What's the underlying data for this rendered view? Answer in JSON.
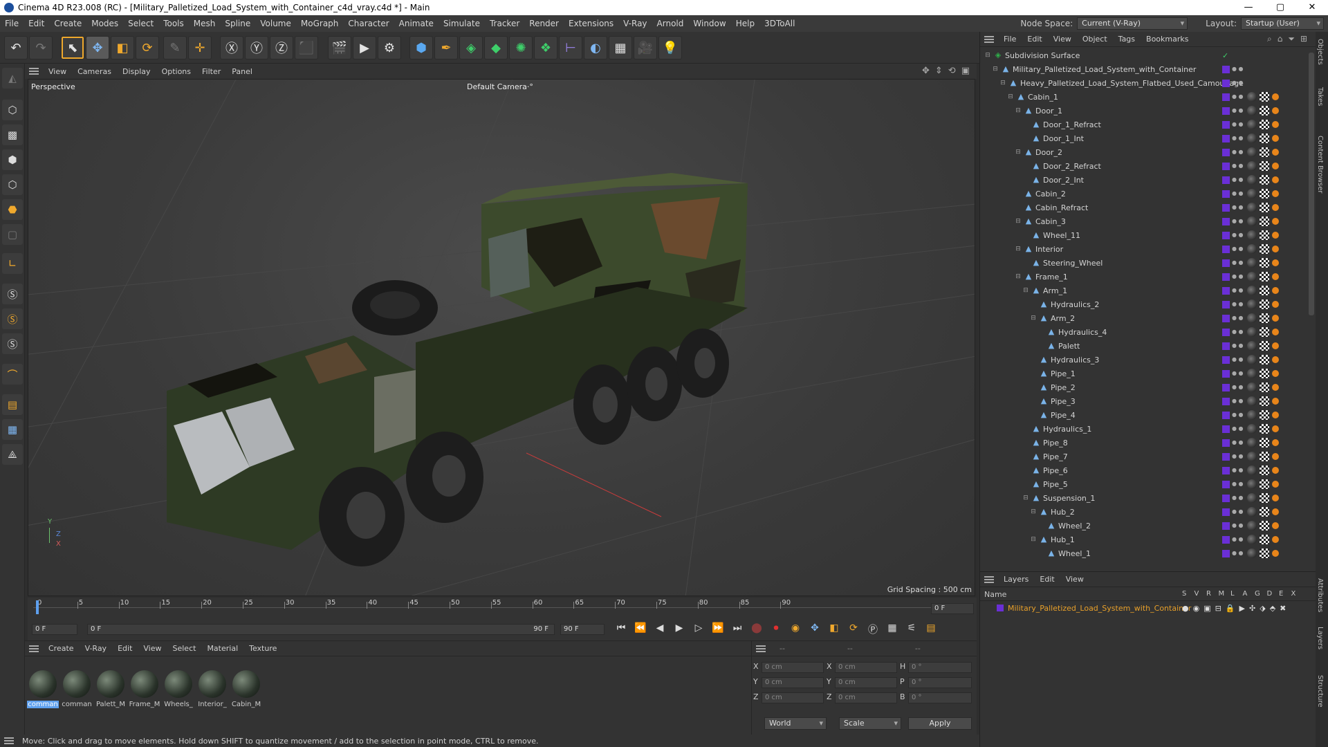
{
  "window": {
    "title": "Cinema 4D R23.008 (RC) - [Military_Palletized_Load_System_with_Container_c4d_vray.c4d *] - Main",
    "minimize": "—",
    "maximize": "▢",
    "close": "✕"
  },
  "menu": [
    "File",
    "Edit",
    "Create",
    "Modes",
    "Select",
    "Tools",
    "Mesh",
    "Spline",
    "Volume",
    "MoGraph",
    "Character",
    "Animate",
    "Simulate",
    "Tracker",
    "Render",
    "Extensions",
    "V-Ray",
    "Arnold",
    "Window",
    "Help",
    "3DToAll"
  ],
  "nodespace": {
    "label": "Node Space:",
    "value": "Current (V-Ray)"
  },
  "layout": {
    "label": "Layout:",
    "value": "Startup (User)"
  },
  "viewport": {
    "menu": [
      "View",
      "Cameras",
      "Display",
      "Options",
      "Filter",
      "Panel"
    ],
    "name": "Perspective",
    "camera": "Default Camera",
    "camera_icon": "·°",
    "grid_spacing": "Grid Spacing : 500 cm",
    "axis_y": "Y",
    "axis_z": "Z",
    "axis_x": "X"
  },
  "timeline": {
    "ticks": [
      "0",
      "5",
      "10",
      "15",
      "20",
      "25",
      "30",
      "35",
      "40",
      "45",
      "50",
      "55",
      "60",
      "65",
      "70",
      "75",
      "80",
      "85",
      "90"
    ],
    "current_frame": "0 F",
    "start": "0 F",
    "range_start": "0 F",
    "range_end": "90 F",
    "end": "90 F"
  },
  "materials": {
    "menu": [
      "Create",
      "V-Ray",
      "Edit",
      "View",
      "Select",
      "Material",
      "Texture"
    ],
    "items": [
      "comman",
      "comman",
      "Palett_M",
      "Frame_M",
      "Wheels_",
      "Interior_",
      "Cabin_M"
    ]
  },
  "coords": {
    "rows": [
      {
        "a": "X",
        "av": "0 cm",
        "b": "X",
        "bv": "0 cm",
        "c": "H",
        "cv": "0 °"
      },
      {
        "a": "Y",
        "av": "0 cm",
        "b": "Y",
        "bv": "0 cm",
        "c": "P",
        "cv": "0 °"
      },
      {
        "a": "Z",
        "av": "0 cm",
        "b": "Z",
        "bv": "0 cm",
        "c": "B",
        "cv": "0 °"
      }
    ],
    "header": [
      "--",
      "--",
      "--"
    ],
    "world": "World",
    "scale": "Scale",
    "apply": "Apply"
  },
  "status": "Move: Click and drag to move elements. Hold down SHIFT to quantize movement / add to the selection in point mode, CTRL to remove.",
  "objects": {
    "menu": [
      "File",
      "Edit",
      "View",
      "Object",
      "Tags",
      "Bookmarks"
    ],
    "tree": [
      {
        "name": "Subdivision Surface",
        "d": 0,
        "t": "-",
        "c": "#2fb04a"
      },
      {
        "name": "Military_Palletized_Load_System_with_Container",
        "d": 1,
        "t": "-",
        "c": "#7ab3e8"
      },
      {
        "name": "Heavy_Palletized_Load_System_Flatbed_Used_Camouflage",
        "d": 2,
        "t": "-",
        "c": "#7ab3e8"
      },
      {
        "name": "Cabin_1",
        "d": 3,
        "t": "-",
        "c": "#7ab3e8"
      },
      {
        "name": "Door_1",
        "d": 4,
        "t": "-",
        "c": "#7ab3e8"
      },
      {
        "name": "Door_1_Refract",
        "d": 5,
        "t": "",
        "c": "#7ab3e8"
      },
      {
        "name": "Door_1_Int",
        "d": 5,
        "t": "",
        "c": "#7ab3e8"
      },
      {
        "name": "Door_2",
        "d": 4,
        "t": "-",
        "c": "#7ab3e8"
      },
      {
        "name": "Door_2_Refract",
        "d": 5,
        "t": "",
        "c": "#7ab3e8"
      },
      {
        "name": "Door_2_Int",
        "d": 5,
        "t": "",
        "c": "#7ab3e8"
      },
      {
        "name": "Cabin_2",
        "d": 4,
        "t": "",
        "c": "#7ab3e8"
      },
      {
        "name": "Cabin_Refract",
        "d": 4,
        "t": "",
        "c": "#7ab3e8"
      },
      {
        "name": "Cabin_3",
        "d": 4,
        "t": "-",
        "c": "#7ab3e8"
      },
      {
        "name": "Wheel_11",
        "d": 5,
        "t": "",
        "c": "#7ab3e8"
      },
      {
        "name": "Interior",
        "d": 4,
        "t": "-",
        "c": "#7ab3e8"
      },
      {
        "name": "Steering_Wheel",
        "d": 5,
        "t": "",
        "c": "#7ab3e8"
      },
      {
        "name": "Frame_1",
        "d": 4,
        "t": "-",
        "c": "#7ab3e8"
      },
      {
        "name": "Arm_1",
        "d": 5,
        "t": "-",
        "c": "#7ab3e8"
      },
      {
        "name": "Hydraulics_2",
        "d": 6,
        "t": "",
        "c": "#7ab3e8"
      },
      {
        "name": "Arm_2",
        "d": 6,
        "t": "-",
        "c": "#7ab3e8"
      },
      {
        "name": "Hydraulics_4",
        "d": 7,
        "t": "",
        "c": "#7ab3e8"
      },
      {
        "name": "Palett",
        "d": 7,
        "t": "",
        "c": "#7ab3e8"
      },
      {
        "name": "Hydraulics_3",
        "d": 6,
        "t": "",
        "c": "#7ab3e8"
      },
      {
        "name": "Pipe_1",
        "d": 6,
        "t": "",
        "c": "#7ab3e8"
      },
      {
        "name": "Pipe_2",
        "d": 6,
        "t": "",
        "c": "#7ab3e8"
      },
      {
        "name": "Pipe_3",
        "d": 6,
        "t": "",
        "c": "#7ab3e8"
      },
      {
        "name": "Pipe_4",
        "d": 6,
        "t": "",
        "c": "#7ab3e8"
      },
      {
        "name": "Hydraulics_1",
        "d": 5,
        "t": "",
        "c": "#7ab3e8"
      },
      {
        "name": "Pipe_8",
        "d": 5,
        "t": "",
        "c": "#7ab3e8"
      },
      {
        "name": "Pipe_7",
        "d": 5,
        "t": "",
        "c": "#7ab3e8"
      },
      {
        "name": "Pipe_6",
        "d": 5,
        "t": "",
        "c": "#7ab3e8"
      },
      {
        "name": "Pipe_5",
        "d": 5,
        "t": "",
        "c": "#7ab3e8"
      },
      {
        "name": "Suspension_1",
        "d": 5,
        "t": "-",
        "c": "#7ab3e8"
      },
      {
        "name": "Hub_2",
        "d": 6,
        "t": "-",
        "c": "#7ab3e8"
      },
      {
        "name": "Wheel_2",
        "d": 7,
        "t": "",
        "c": "#7ab3e8"
      },
      {
        "name": "Hub_1",
        "d": 6,
        "t": "-",
        "c": "#7ab3e8"
      },
      {
        "name": "Wheel_1",
        "d": 7,
        "t": "",
        "c": "#7ab3e8"
      }
    ]
  },
  "layers": {
    "menu": [
      "Layers",
      "Edit",
      "View"
    ],
    "name_header": "Name",
    "flags": [
      "S",
      "V",
      "R",
      "M",
      "L",
      "A",
      "G",
      "D",
      "E",
      "X"
    ],
    "item": "Military_Palletized_Load_System_with_Container",
    "item_color": "#e8a02a"
  },
  "side_tabs": [
    "Objects",
    "Takes",
    "Content Browser",
    "Attributes",
    "Layers",
    "Structure"
  ]
}
